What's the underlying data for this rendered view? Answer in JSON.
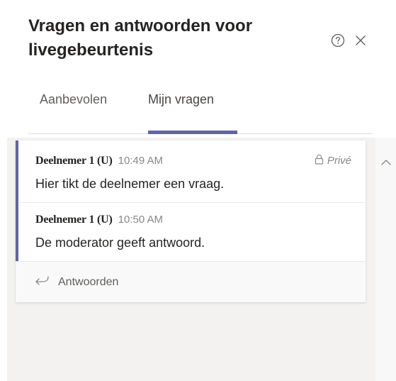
{
  "header": {
    "title": "Vragen en antwoorden voor livegebeurtenis",
    "help_icon": "help-circle-icon",
    "close_icon": "close-icon"
  },
  "tabs": [
    {
      "label": "Aanbevolen",
      "selected": false
    },
    {
      "label": "Mijn vragen",
      "selected": true
    }
  ],
  "thread": {
    "private_label": "Privé",
    "private_icon": "lock-icon",
    "messages": [
      {
        "author": "Deelnemer 1 (U)",
        "time": "10:49 AM",
        "text": "Hier tikt de deelnemer een vraag."
      },
      {
        "author": "Deelnemer 1 (U)",
        "time": "10:50 AM",
        "text": "De moderator geeft antwoord."
      }
    ],
    "reply_label": "Antwoorden",
    "reply_icon": "reply-arrow-icon"
  },
  "colors": {
    "accent": "#6264a7",
    "background_gray": "#f3f2f1",
    "text_primary": "#252423",
    "text_secondary": "#8a8886"
  }
}
